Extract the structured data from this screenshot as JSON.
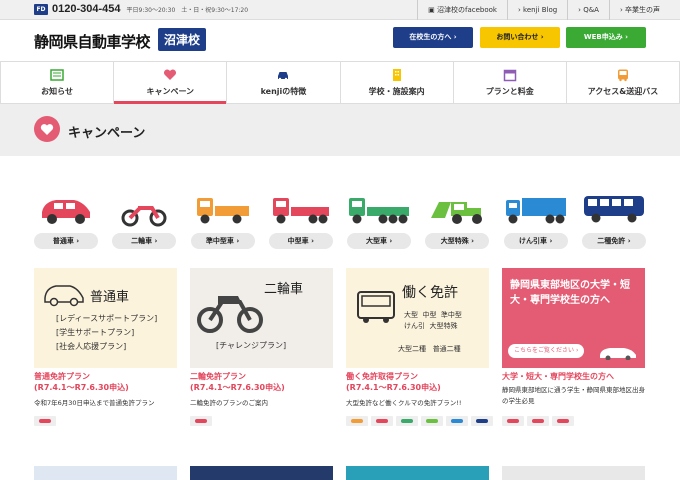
{
  "topbar": {
    "tel": "0120-304-454",
    "hours": "平日9:30〜20:30　土・日・祝9:30〜17:20",
    "links": [
      "沼津校のfacebook",
      "kenji Blog",
      "Q&A",
      "卒業生の声"
    ]
  },
  "header": {
    "logo": "静岡県自動車学校",
    "badge": "沼津校",
    "buttons": [
      {
        "label": "在校生の方へ ›",
        "color": "#1e3e8a"
      },
      {
        "label": "お問い合わせ ›",
        "color": "#f7c600"
      },
      {
        "label": "WEB申込み ›",
        "color": "#3aaa35"
      }
    ]
  },
  "nav": [
    {
      "label": "お知らせ",
      "icon": "news-icon"
    },
    {
      "label": "キャンペーン",
      "icon": "heart-icon",
      "active": true
    },
    {
      "label": "kenjiの特徴",
      "icon": "car-icon"
    },
    {
      "label": "学校・施設案内",
      "icon": "building-icon"
    },
    {
      "label": "プランと料金",
      "icon": "calendar-icon"
    },
    {
      "label": "アクセス&送迎バス",
      "icon": "bus-icon"
    }
  ],
  "page_title": "キャンペーン",
  "vehicles": [
    {
      "label": "普通車 ›",
      "icon": "car-icon",
      "color": "#e4465c"
    },
    {
      "label": "二輪車 ›",
      "icon": "motorcycle-icon",
      "color": "#e4465c"
    },
    {
      "label": "準中型車 ›",
      "icon": "truck-icon",
      "color": "#f29c38"
    },
    {
      "label": "中型車 ›",
      "icon": "truck-icon",
      "color": "#e4465c"
    },
    {
      "label": "大型車 ›",
      "icon": "truck-icon",
      "color": "#3aaa6a"
    },
    {
      "label": "大型特殊 ›",
      "icon": "loader-icon",
      "color": "#6bc040"
    },
    {
      "label": "けん引車 ›",
      "icon": "trailer-icon",
      "color": "#2a8ad4"
    },
    {
      "label": "二種免許 ›",
      "icon": "bus-icon",
      "color": "#1e3e8a"
    }
  ],
  "cards": [
    {
      "img_heading": "普通車",
      "img_lines": [
        "[レディースサポートプラン]",
        "[学生サポートプラン]",
        "[社会人応援プラン]"
      ],
      "title": "普通免許プラン\n(R7.4.1〜R7.6.30申込)",
      "desc": "令和7年6月30日申込まで普通免許プラン",
      "tags": [
        "#e4465c"
      ]
    },
    {
      "img_heading": "二輪車",
      "img_lines": [
        "[チャレンジプラン]"
      ],
      "title": "二輪免許プラン\n(R7.4.1〜R7.6.30申込)",
      "desc": "二輪免許のプランのご案内",
      "tags": [
        "#e4465c"
      ]
    },
    {
      "img_heading": "働く免許",
      "img_lines": [
        "大型",
        "中型",
        "準中型",
        "けん引",
        "大型特殊",
        "大型二種",
        "普通二種"
      ],
      "title": "働く免許取得プラン\n(R7.4.1〜R7.6.30申込)",
      "desc": "大型免許など働くクルマの免許プラン!!",
      "tags": [
        "#f29c38",
        "#e4465c",
        "#3aaa6a",
        "#6bc040",
        "#2a8ad4",
        "#1e3e8a"
      ]
    },
    {
      "img_heading": "静岡県東部地区の大学・短大・専門学校生の方へ",
      "img_lines": [
        "こちらをご覧ください"
      ],
      "title": "大学・短大・専門学校生の方へ",
      "desc": "静岡県東部地区に通う学生・静岡県東部地区出身の学生必見",
      "tags": [
        "#e4465c",
        "#e4465c",
        "#e4465c"
      ]
    }
  ]
}
